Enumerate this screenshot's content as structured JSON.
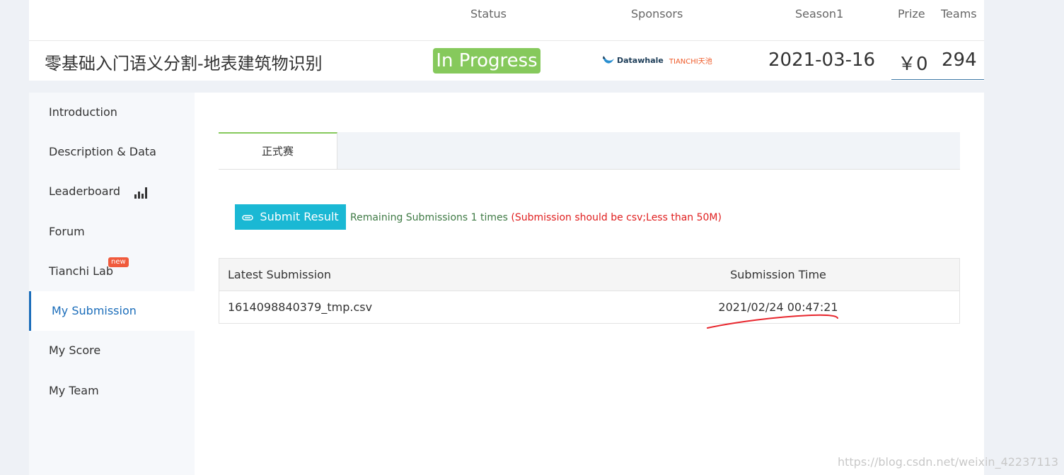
{
  "header": {
    "columns": {
      "status": "Status",
      "sponsors": "Sponsors",
      "season": "Season1",
      "prize": "Prize",
      "teams": "Teams"
    },
    "title": "零基础入门语义分割-地表建筑物识别",
    "status_value": "In Progress",
    "sponsor_logos": {
      "datawhale": "Datawhale",
      "tianchi": "TIANCHI天池"
    },
    "season_value": "2021-03-16",
    "prize_value": "￥0",
    "teams_value": "294"
  },
  "sidebar": {
    "items": [
      {
        "label": "Introduction"
      },
      {
        "label": "Description & Data"
      },
      {
        "label": "Leaderboard",
        "icon": "bar-chart-icon"
      },
      {
        "label": "Forum"
      },
      {
        "label": "Tianchi Lab",
        "badge": "new"
      },
      {
        "label": "My Submission",
        "active": true
      },
      {
        "label": "My Score"
      },
      {
        "label": "My Team"
      }
    ]
  },
  "main": {
    "tab_label": "正式赛",
    "submit_label": "Submit Result",
    "remaining_text": "Remaining Submissions 1 times",
    "warning_text": "(Submission should be csv;Less than 50M)",
    "table": {
      "headers": [
        "Latest Submission",
        "Submission Time"
      ],
      "rows": [
        [
          "1614098840379_tmp.csv",
          "2021/02/24 00:47:21"
        ]
      ]
    }
  },
  "watermark": "https://blog.csdn.net/weixin_42237113",
  "colors": {
    "accent": "#1b6dba",
    "status_green": "#86c95c",
    "button_cyan": "#1ab8d4",
    "warning_red": "#e02020",
    "annotation_red": "#e8262d"
  }
}
